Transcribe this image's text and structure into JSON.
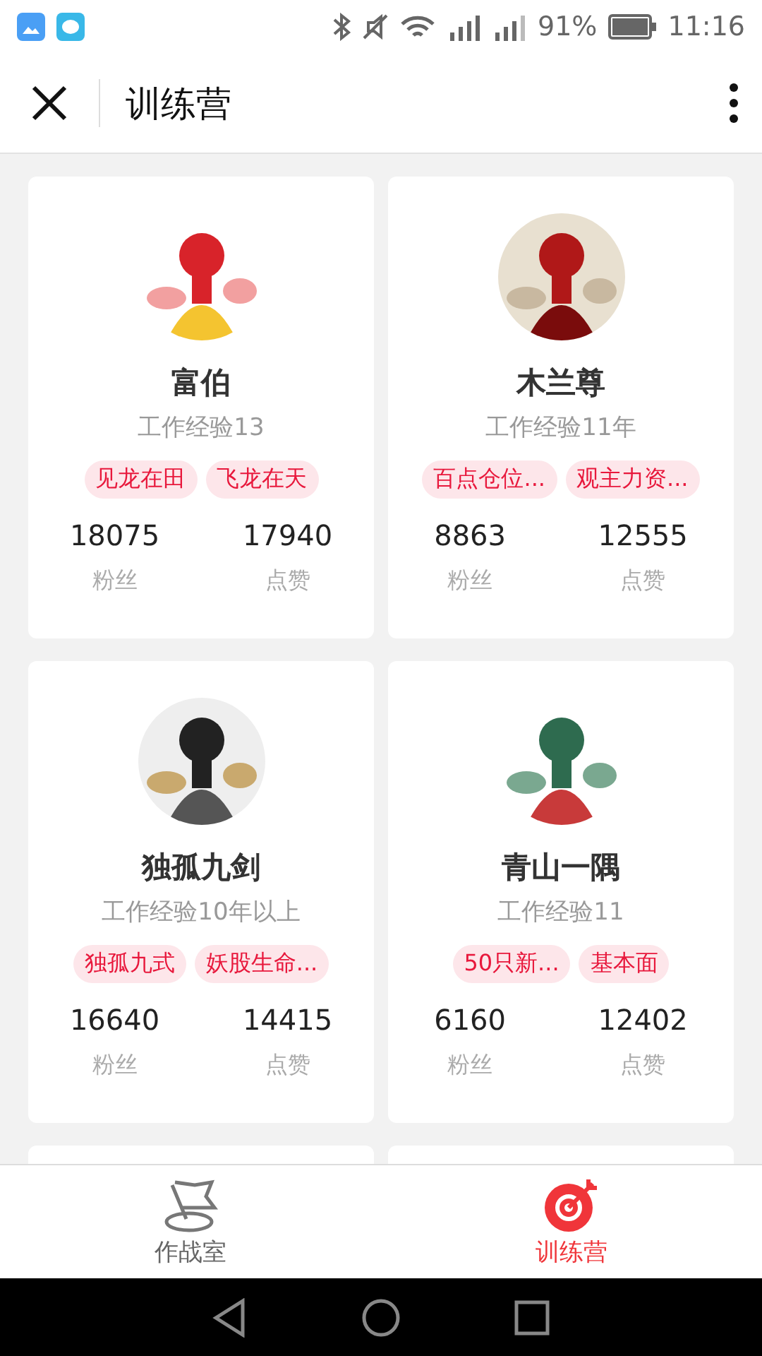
{
  "status_bar": {
    "battery": "91%",
    "time": "11:16"
  },
  "header": {
    "title": "训练营"
  },
  "cards": [
    {
      "name": "富伯",
      "experience": "工作经验13",
      "tags": [
        "见龙在田",
        "飞龙在天"
      ],
      "stats": [
        {
          "value": "18075",
          "label": "粉丝"
        },
        {
          "value": "17940",
          "label": "点赞"
        }
      ]
    },
    {
      "name": "木兰尊",
      "experience": "工作经验11年",
      "tags": [
        "百点仓位...",
        "观主力资..."
      ],
      "stats": [
        {
          "value": "8863",
          "label": "粉丝"
        },
        {
          "value": "12555",
          "label": "点赞"
        }
      ]
    },
    {
      "name": "独孤九剑",
      "experience": "工作经验10年以上",
      "tags": [
        "独孤九式",
        "妖股生命..."
      ],
      "stats": [
        {
          "value": "16640",
          "label": "粉丝"
        },
        {
          "value": "14415",
          "label": "点赞"
        }
      ]
    },
    {
      "name": "青山一隅",
      "experience": "工作经验11",
      "tags": [
        "50只新...",
        "基本面"
      ],
      "stats": [
        {
          "value": "6160",
          "label": "粉丝"
        },
        {
          "value": "12402",
          "label": "点赞"
        }
      ]
    }
  ],
  "tab_bar": [
    {
      "label": "作战室",
      "selected": false
    },
    {
      "label": "训练营",
      "selected": true
    }
  ]
}
